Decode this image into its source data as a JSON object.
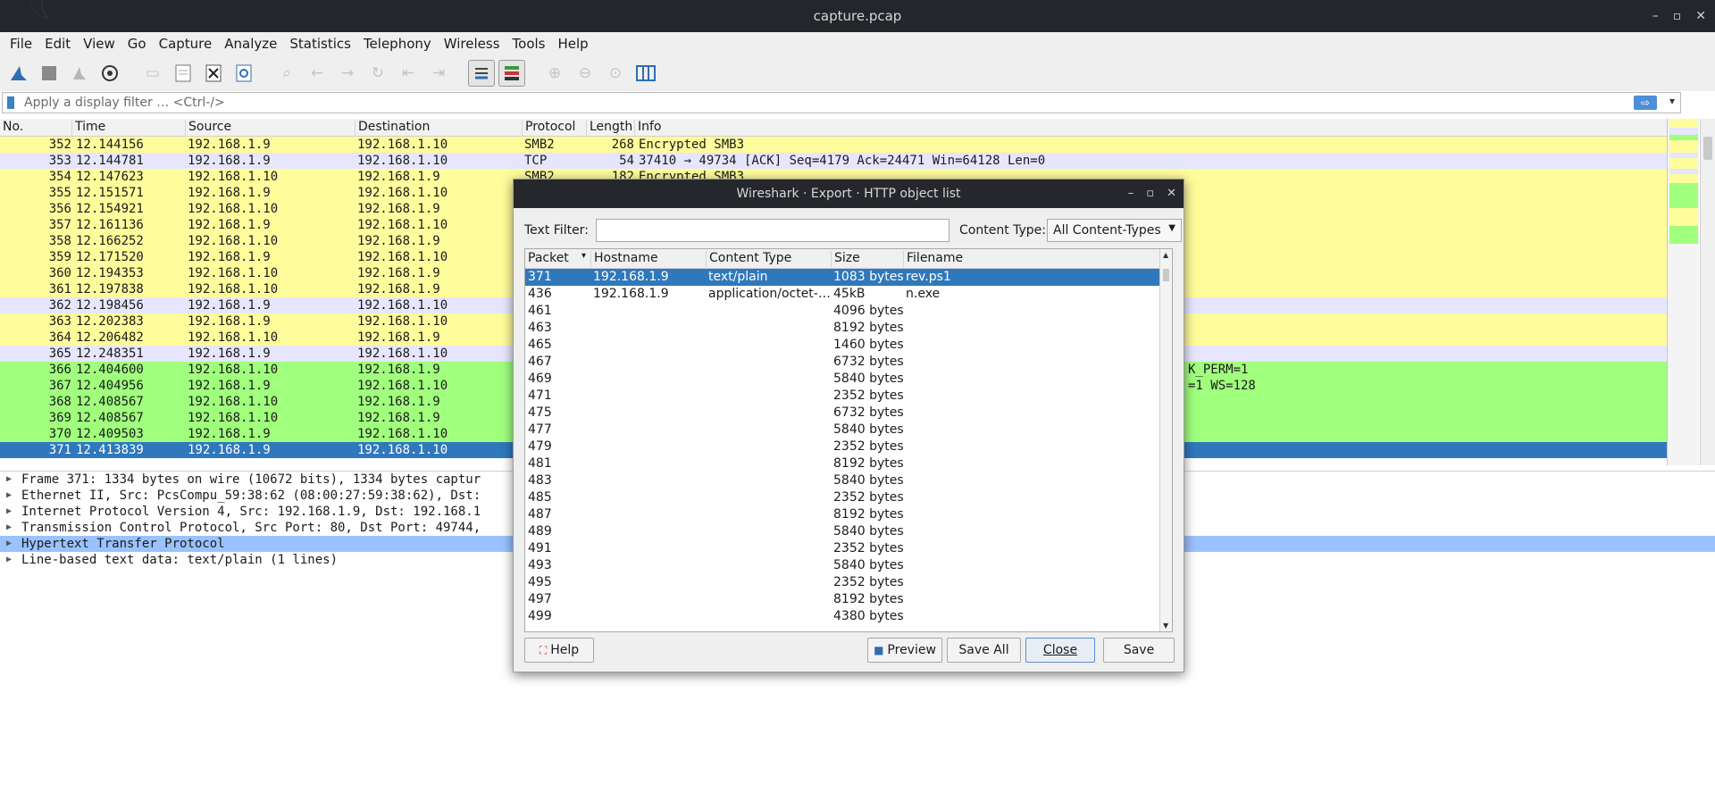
{
  "window": {
    "title": "capture.pcap",
    "controls": [
      "–",
      "▫",
      "✕"
    ]
  },
  "menu": [
    "File",
    "Edit",
    "View",
    "Go",
    "Capture",
    "Analyze",
    "Statistics",
    "Telephony",
    "Wireless",
    "Tools",
    "Help"
  ],
  "filter": {
    "placeholder": "Apply a display filter … <Ctrl-/>",
    "apply_icon": "⇨",
    "dropdown_icon": "▾"
  },
  "packet_list": {
    "headers": [
      "No.",
      "Time",
      "Source",
      "Destination",
      "Protocol",
      "Length",
      "Info"
    ],
    "rows": [
      {
        "no": "352",
        "time": "12.144156",
        "src": "192.168.1.9",
        "dst": "192.168.1.10",
        "proto": "SMB2",
        "len": "268",
        "info": "Encrypted SMB3",
        "color": "y"
      },
      {
        "no": "353",
        "time": "12.144781",
        "src": "192.168.1.9",
        "dst": "192.168.1.10",
        "proto": "TCP",
        "len": "54",
        "info": "37410 → 49734 [ACK] Seq=4179 Ack=24471 Win=64128 Len=0",
        "color": "l"
      },
      {
        "no": "354",
        "time": "12.147623",
        "src": "192.168.1.10",
        "dst": "192.168.1.9",
        "proto": "SMB2",
        "len": "182",
        "info": "Encrypted SMB3",
        "color": "y"
      },
      {
        "no": "355",
        "time": "12.151571",
        "src": "192.168.1.9",
        "dst": "192.168.1.10",
        "proto": "",
        "len": "",
        "info": "",
        "color": "y"
      },
      {
        "no": "356",
        "time": "12.154921",
        "src": "192.168.1.10",
        "dst": "192.168.1.9",
        "proto": "",
        "len": "",
        "info": "",
        "color": "y"
      },
      {
        "no": "357",
        "time": "12.161136",
        "src": "192.168.1.9",
        "dst": "192.168.1.10",
        "proto": "",
        "len": "",
        "info": "",
        "color": "y"
      },
      {
        "no": "358",
        "time": "12.166252",
        "src": "192.168.1.10",
        "dst": "192.168.1.9",
        "proto": "",
        "len": "",
        "info": "",
        "color": "y"
      },
      {
        "no": "359",
        "time": "12.171520",
        "src": "192.168.1.9",
        "dst": "192.168.1.10",
        "proto": "",
        "len": "",
        "info": "",
        "color": "y"
      },
      {
        "no": "360",
        "time": "12.194353",
        "src": "192.168.1.10",
        "dst": "192.168.1.9",
        "proto": "",
        "len": "",
        "info": "",
        "color": "y"
      },
      {
        "no": "361",
        "time": "12.197838",
        "src": "192.168.1.10",
        "dst": "192.168.1.9",
        "proto": "",
        "len": "",
        "info": "",
        "color": "y"
      },
      {
        "no": "362",
        "time": "12.198456",
        "src": "192.168.1.9",
        "dst": "192.168.1.10",
        "proto": "",
        "len": "",
        "info": "",
        "color": "l"
      },
      {
        "no": "363",
        "time": "12.202383",
        "src": "192.168.1.9",
        "dst": "192.168.1.10",
        "proto": "",
        "len": "",
        "info": "",
        "color": "y"
      },
      {
        "no": "364",
        "time": "12.206482",
        "src": "192.168.1.10",
        "dst": "192.168.1.9",
        "proto": "",
        "len": "",
        "info": "",
        "color": "y"
      },
      {
        "no": "365",
        "time": "12.248351",
        "src": "192.168.1.9",
        "dst": "192.168.1.10",
        "proto": "",
        "len": "",
        "info": "",
        "color": "l"
      },
      {
        "no": "366",
        "time": "12.404600",
        "src": "192.168.1.10",
        "dst": "192.168.1.9",
        "proto": "",
        "len": "",
        "info": "K_PERM=1",
        "color": "g"
      },
      {
        "no": "367",
        "time": "12.404956",
        "src": "192.168.1.9",
        "dst": "192.168.1.10",
        "proto": "",
        "len": "",
        "info": "=1 WS=128",
        "color": "g"
      },
      {
        "no": "368",
        "time": "12.408567",
        "src": "192.168.1.10",
        "dst": "192.168.1.9",
        "proto": "",
        "len": "",
        "info": "",
        "color": "g"
      },
      {
        "no": "369",
        "time": "12.408567",
        "src": "192.168.1.10",
        "dst": "192.168.1.9",
        "proto": "",
        "len": "",
        "info": "",
        "color": "g"
      },
      {
        "no": "370",
        "time": "12.409503",
        "src": "192.168.1.9",
        "dst": "192.168.1.10",
        "proto": "",
        "len": "",
        "info": "",
        "color": "g"
      },
      {
        "no": "371",
        "time": "12.413839",
        "src": "192.168.1.9",
        "dst": "192.168.1.10",
        "proto": "",
        "len": "",
        "info": "",
        "color": "sel"
      }
    ]
  },
  "details": [
    {
      "text": "Frame 371: 1334 bytes on wire (10672 bits), 1334 bytes captur",
      "hl": false
    },
    {
      "text": "Ethernet II, Src: PcsCompu_59:38:62 (08:00:27:59:38:62), Dst:",
      "hl": false
    },
    {
      "text": "Internet Protocol Version 4, Src: 192.168.1.9, Dst: 192.168.1",
      "hl": false
    },
    {
      "text": "Transmission Control Protocol, Src Port: 80, Dst Port: 49744,",
      "hl": false
    },
    {
      "text": "Hypertext Transfer Protocol",
      "hl": true
    },
    {
      "text": "Line-based text data: text/plain (1 lines)",
      "hl": false
    }
  ],
  "dialog": {
    "title": "Wireshark · Export · HTTP object list",
    "text_filter_label": "Text Filter:",
    "text_filter_value": "",
    "content_type_label": "Content Type:",
    "content_type_value": "All Content-Types",
    "headers": [
      "Packet",
      "Hostname",
      "Content Type",
      "Size",
      "Filename"
    ],
    "sort_icon": "▾",
    "rows": [
      {
        "packet": "371",
        "host": "192.168.1.9",
        "ctype": "text/plain",
        "size": "1083 bytes",
        "file": "rev.ps1",
        "sel": true
      },
      {
        "packet": "436",
        "host": "192.168.1.9",
        "ctype": "application/octet-…",
        "size": "45kB",
        "file": "n.exe",
        "sel": false
      },
      {
        "packet": "461",
        "host": "",
        "ctype": "",
        "size": "4096 bytes",
        "file": "",
        "sel": false
      },
      {
        "packet": "463",
        "host": "",
        "ctype": "",
        "size": "8192 bytes",
        "file": "",
        "sel": false
      },
      {
        "packet": "465",
        "host": "",
        "ctype": "",
        "size": "1460 bytes",
        "file": "",
        "sel": false
      },
      {
        "packet": "467",
        "host": "",
        "ctype": "",
        "size": "6732 bytes",
        "file": "",
        "sel": false
      },
      {
        "packet": "469",
        "host": "",
        "ctype": "",
        "size": "5840 bytes",
        "file": "",
        "sel": false
      },
      {
        "packet": "471",
        "host": "",
        "ctype": "",
        "size": "2352 bytes",
        "file": "",
        "sel": false
      },
      {
        "packet": "475",
        "host": "",
        "ctype": "",
        "size": "6732 bytes",
        "file": "",
        "sel": false
      },
      {
        "packet": "477",
        "host": "",
        "ctype": "",
        "size": "5840 bytes",
        "file": "",
        "sel": false
      },
      {
        "packet": "479",
        "host": "",
        "ctype": "",
        "size": "2352 bytes",
        "file": "",
        "sel": false
      },
      {
        "packet": "481",
        "host": "",
        "ctype": "",
        "size": "8192 bytes",
        "file": "",
        "sel": false
      },
      {
        "packet": "483",
        "host": "",
        "ctype": "",
        "size": "5840 bytes",
        "file": "",
        "sel": false
      },
      {
        "packet": "485",
        "host": "",
        "ctype": "",
        "size": "2352 bytes",
        "file": "",
        "sel": false
      },
      {
        "packet": "487",
        "host": "",
        "ctype": "",
        "size": "8192 bytes",
        "file": "",
        "sel": false
      },
      {
        "packet": "489",
        "host": "",
        "ctype": "",
        "size": "5840 bytes",
        "file": "",
        "sel": false
      },
      {
        "packet": "491",
        "host": "",
        "ctype": "",
        "size": "2352 bytes",
        "file": "",
        "sel": false
      },
      {
        "packet": "493",
        "host": "",
        "ctype": "",
        "size": "5840 bytes",
        "file": "",
        "sel": false
      },
      {
        "packet": "495",
        "host": "",
        "ctype": "",
        "size": "2352 bytes",
        "file": "",
        "sel": false
      },
      {
        "packet": "497",
        "host": "",
        "ctype": "",
        "size": "8192 bytes",
        "file": "",
        "sel": false
      },
      {
        "packet": "499",
        "host": "",
        "ctype": "",
        "size": "4380 bytes",
        "file": "",
        "sel": false
      }
    ],
    "buttons": {
      "help": "Help",
      "preview": "Preview",
      "save_all": "Save All",
      "close": "Close",
      "save": "Save"
    }
  },
  "colors": {
    "yellow_row": "#fffc9c",
    "lavender_row": "#e7e6ff",
    "green_row": "#a0ff7d",
    "selection": "#2f78bc",
    "detail_highlight": "#99c2ff",
    "titlebar": "#24262b"
  },
  "icons": {
    "toolbar": [
      "shark-fin-start-icon",
      "stop-icon",
      "restart-icon",
      "capture-options-icon",
      "open-file-icon",
      "save-file-icon",
      "close-file-icon",
      "reload-icon",
      "search-icon",
      "back-icon",
      "forward-icon",
      "jump-icon",
      "first-icon",
      "last-icon",
      "autoscroll-icon",
      "colorize-icon",
      "zoom-in-icon",
      "zoom-out-icon",
      "normal-size-icon",
      "resize-columns-icon"
    ]
  }
}
